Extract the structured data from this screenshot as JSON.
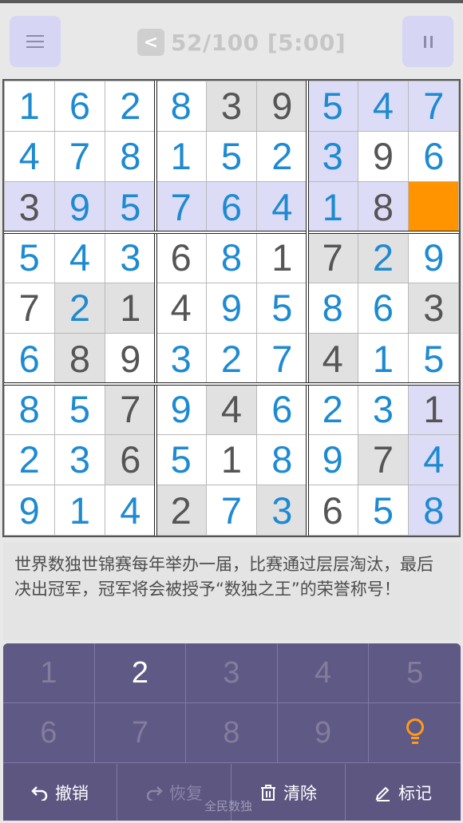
{
  "header": {
    "menu_icon": "menu-icon",
    "back_label": "<",
    "progress_text": "52/100 [5:00]",
    "pause_icon": "pause-icon"
  },
  "board": {
    "rows": [
      [
        "1",
        "6",
        "2",
        "8",
        "3",
        "9",
        "5",
        "4",
        "7"
      ],
      [
        "4",
        "7",
        "8",
        "1",
        "5",
        "2",
        "3",
        "9",
        "6"
      ],
      [
        "3",
        "9",
        "5",
        "7",
        "6",
        "4",
        "1",
        "8",
        ""
      ],
      [
        "5",
        "4",
        "3",
        "6",
        "8",
        "1",
        "7",
        "2",
        "9"
      ],
      [
        "7",
        "2",
        "1",
        "4",
        "9",
        "5",
        "8",
        "6",
        "3"
      ],
      [
        "6",
        "8",
        "9",
        "3",
        "2",
        "7",
        "4",
        "1",
        "5"
      ],
      [
        "8",
        "5",
        "7",
        "9",
        "4",
        "6",
        "2",
        "3",
        "1"
      ],
      [
        "2",
        "3",
        "6",
        "5",
        "1",
        "8",
        "9",
        "7",
        "4"
      ],
      [
        "9",
        "1",
        "4",
        "2",
        "7",
        "3",
        "6",
        "5",
        "8"
      ]
    ],
    "given": [
      "000011000",
      "000000010",
      "100000010",
      "000101100",
      "101100001",
      "011000100",
      "001010001",
      "001010010",
      "000200100"
    ],
    "selected_cell": "row 3, col 9",
    "colors": {
      "given_digit": "#555555",
      "user_digit": "#1d8ad1",
      "highlight": "#dcdcf7",
      "selected": "#ff9400",
      "grey_cell": "#e1e1e1"
    }
  },
  "message": {
    "text": "世界数独世锦赛每年举办一届，比赛通过层层淘汰，最后决出冠军，冠军将会被授予“数独之王”的荣誉称号！"
  },
  "keypad": {
    "keys": [
      "1",
      "2",
      "3",
      "4",
      "5",
      "6",
      "7",
      "8",
      "9"
    ],
    "active_key": "2",
    "hint_icon": "lightbulb-icon",
    "actions": {
      "undo": "撤销",
      "redo": "恢复",
      "clear": "清除",
      "mark": "标记"
    },
    "footer_caption": "全民数独"
  }
}
